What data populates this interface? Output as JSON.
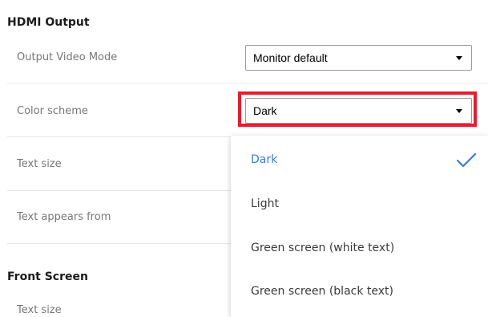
{
  "hdmi_output": {
    "title": "HDMI Output",
    "output_video_mode": {
      "label": "Output Video Mode",
      "value": "Monitor default"
    },
    "color_scheme": {
      "label": "Color scheme",
      "value": "Dark"
    },
    "text_size": {
      "label": "Text size"
    },
    "text_appears_from": {
      "label": "Text appears from"
    }
  },
  "front_screen": {
    "title": "Front Screen",
    "text_size": {
      "label": "Text size"
    }
  },
  "color_scheme_dropdown": {
    "options": [
      {
        "label": "Dark",
        "selected": true
      },
      {
        "label": "Light",
        "selected": false
      },
      {
        "label": "Green screen (white text)",
        "selected": false
      },
      {
        "label": "Green screen (black text)",
        "selected": false
      }
    ]
  },
  "colors": {
    "selected_option": "#3a7bd5",
    "highlight_box": "#e0202e"
  },
  "icons": {
    "selected_marker": "check-icon",
    "dropdown_indicator": "caret-down-icon"
  }
}
